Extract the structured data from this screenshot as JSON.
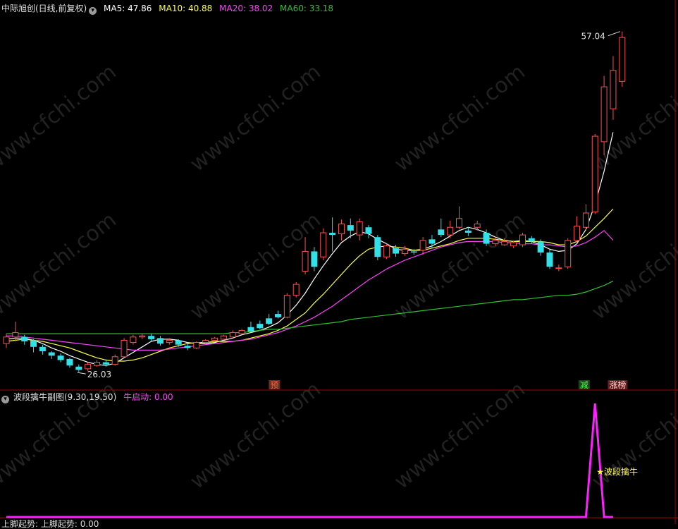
{
  "main_header": {
    "title": "中际旭创(日线,前复权)",
    "ma5": "MA5: 47.86",
    "ma10": "MA10: 40.88",
    "ma20": "MA20: 38.02",
    "ma60": "MA60: 33.18"
  },
  "sub_header": {
    "title": "波段擒牛副图(9.30,19.50)",
    "value": "牛启动: 0.00"
  },
  "footer_header": {
    "text": "上脚起势: 上脚起势: 0.00"
  },
  "watermark": "www.cfchi.com",
  "colors": {
    "up": "#ff5050",
    "down": "#33e0e8",
    "ma5": "#ffffff",
    "ma10": "#ffff40",
    "ma20": "#ff40ff",
    "ma60": "#30c030",
    "signal": "#ff20ff",
    "star": "#ffff40"
  },
  "chart_data": [
    {
      "type": "candlestick",
      "title": "中际旭创(日线,前复权)",
      "annotations": {
        "high": "57.04",
        "low": "26.03",
        "marks": [
          "预",
          "减",
          "涨榜"
        ]
      },
      "candles": [
        {
          "o": 28.6,
          "c": 29.2,
          "h": 29.5,
          "l": 28.2
        },
        {
          "o": 29.2,
          "c": 29.6,
          "h": 30.6,
          "l": 28.8
        },
        {
          "o": 29.2,
          "c": 28.8,
          "h": 29.4,
          "l": 28.5
        },
        {
          "o": 28.9,
          "c": 28.3,
          "h": 29.0,
          "l": 27.8
        },
        {
          "o": 28.3,
          "c": 27.9,
          "h": 28.5,
          "l": 27.6
        },
        {
          "o": 27.8,
          "c": 27.5,
          "h": 27.9,
          "l": 27.2
        },
        {
          "o": 27.5,
          "c": 27.1,
          "h": 27.7,
          "l": 26.9
        },
        {
          "o": 27.2,
          "c": 26.6,
          "h": 27.3,
          "l": 26.4
        },
        {
          "o": 26.5,
          "c": 26.2,
          "h": 26.7,
          "l": 26.03
        },
        {
          "o": 26.3,
          "c": 26.7,
          "h": 26.9,
          "l": 26.1
        },
        {
          "o": 26.6,
          "c": 26.9,
          "h": 27.1,
          "l": 26.5
        },
        {
          "o": 26.9,
          "c": 26.7,
          "h": 27.1,
          "l": 26.5
        },
        {
          "o": 26.7,
          "c": 27.4,
          "h": 27.6,
          "l": 26.6
        },
        {
          "o": 27.4,
          "c": 28.9,
          "h": 29.1,
          "l": 27.3
        },
        {
          "o": 28.7,
          "c": 29.2,
          "h": 29.4,
          "l": 28.5
        },
        {
          "o": 29.2,
          "c": 29.3,
          "h": 29.5,
          "l": 29.0
        },
        {
          "o": 29.3,
          "c": 29.0,
          "h": 29.5,
          "l": 28.8
        },
        {
          "o": 29.1,
          "c": 28.6,
          "h": 29.3,
          "l": 28.4
        },
        {
          "o": 28.7,
          "c": 28.9,
          "h": 29.1,
          "l": 28.5
        },
        {
          "o": 28.9,
          "c": 28.5,
          "h": 29.0,
          "l": 28.3
        },
        {
          "o": 28.4,
          "c": 28.2,
          "h": 28.6,
          "l": 28.0
        },
        {
          "o": 28.2,
          "c": 28.7,
          "h": 28.8,
          "l": 28.1
        },
        {
          "o": 28.7,
          "c": 28.9,
          "h": 29.0,
          "l": 28.6
        },
        {
          "o": 28.9,
          "c": 29.1,
          "h": 29.2,
          "l": 28.8
        },
        {
          "o": 29.0,
          "c": 29.3,
          "h": 29.4,
          "l": 28.9
        },
        {
          "o": 29.2,
          "c": 29.6,
          "h": 29.8,
          "l": 29.1
        },
        {
          "o": 29.5,
          "c": 29.8,
          "h": 29.9,
          "l": 29.4
        },
        {
          "o": 30.1,
          "c": 29.7,
          "h": 30.6,
          "l": 29.6
        },
        {
          "o": 30.4,
          "c": 30.0,
          "h": 30.7,
          "l": 29.9
        },
        {
          "o": 30.9,
          "c": 30.4,
          "h": 31.3,
          "l": 30.3
        },
        {
          "o": 31.3,
          "c": 31.0,
          "h": 31.6,
          "l": 30.9
        },
        {
          "o": 31.0,
          "c": 33.0,
          "h": 33.2,
          "l": 30.9
        },
        {
          "o": 33.0,
          "c": 34.0,
          "h": 34.2,
          "l": 32.8
        },
        {
          "o": 35.2,
          "c": 37.0,
          "h": 38.3,
          "l": 34.9
        },
        {
          "o": 37.0,
          "c": 35.6,
          "h": 37.4,
          "l": 35.2
        },
        {
          "o": 36.5,
          "c": 38.7,
          "h": 39.1,
          "l": 36.2
        },
        {
          "o": 38.7,
          "c": 38.5,
          "h": 40.1,
          "l": 37.0
        },
        {
          "o": 38.6,
          "c": 39.5,
          "h": 39.9,
          "l": 38.0
        },
        {
          "o": 39.4,
          "c": 38.9,
          "h": 40.0,
          "l": 38.2
        },
        {
          "o": 38.5,
          "c": 39.7,
          "h": 40.0,
          "l": 38.0
        },
        {
          "o": 39.2,
          "c": 38.6,
          "h": 39.4,
          "l": 38.2
        },
        {
          "o": 38.3,
          "c": 36.5,
          "h": 38.5,
          "l": 36.2
        },
        {
          "o": 36.5,
          "c": 37.5,
          "h": 37.7,
          "l": 36.3
        },
        {
          "o": 37.3,
          "c": 36.8,
          "h": 37.6,
          "l": 36.5
        },
        {
          "o": 36.8,
          "c": 37.2,
          "h": 37.5,
          "l": 36.6
        },
        {
          "o": 37.0,
          "c": 36.9,
          "h": 37.2,
          "l": 36.7
        },
        {
          "o": 37.1,
          "c": 38.0,
          "h": 38.3,
          "l": 36.7
        },
        {
          "o": 38.1,
          "c": 37.7,
          "h": 38.5,
          "l": 37.3
        },
        {
          "o": 39.0,
          "c": 38.5,
          "h": 40.0,
          "l": 38.3
        },
        {
          "o": 38.5,
          "c": 39.2,
          "h": 39.8,
          "l": 38.2
        },
        {
          "o": 39.2,
          "c": 40.0,
          "h": 41.1,
          "l": 39.0
        },
        {
          "o": 38.9,
          "c": 38.7,
          "h": 39.2,
          "l": 38.4
        },
        {
          "o": 39.2,
          "c": 39.5,
          "h": 39.8,
          "l": 38.9
        },
        {
          "o": 38.7,
          "c": 37.7,
          "h": 39.0,
          "l": 37.5
        },
        {
          "o": 37.7,
          "c": 38.0,
          "h": 38.3,
          "l": 37.5
        },
        {
          "o": 37.6,
          "c": 37.9,
          "h": 38.2,
          "l": 37.5
        },
        {
          "o": 37.5,
          "c": 37.8,
          "h": 38.0,
          "l": 37.3
        },
        {
          "o": 37.6,
          "c": 38.5,
          "h": 38.7,
          "l": 37.4
        },
        {
          "o": 38.2,
          "c": 37.9,
          "h": 38.4,
          "l": 37.7
        },
        {
          "o": 37.9,
          "c": 36.9,
          "h": 38.1,
          "l": 36.6
        },
        {
          "o": 36.9,
          "c": 35.6,
          "h": 37.2,
          "l": 35.4
        },
        {
          "o": 35.5,
          "c": 35.5,
          "h": 35.8,
          "l": 35.2
        },
        {
          "o": 35.6,
          "c": 38.0,
          "h": 38.2,
          "l": 35.4
        },
        {
          "o": 38.0,
          "c": 39.3,
          "h": 40.2,
          "l": 37.8
        },
        {
          "o": 39.2,
          "c": 40.5,
          "h": 41.3,
          "l": 38.9
        },
        {
          "o": 40.6,
          "c": 47.5,
          "h": 47.7,
          "l": 40.4
        },
        {
          "o": 47.0,
          "c": 52.0,
          "h": 53.0,
          "l": 45.8
        },
        {
          "o": 50.0,
          "c": 53.5,
          "h": 54.8,
          "l": 49.0
        },
        {
          "o": 52.5,
          "c": 56.5,
          "h": 57.04,
          "l": 52.0
        }
      ],
      "ma_series": [
        {
          "name": "MA5",
          "values": [
            29.0,
            29.1,
            29.1,
            28.9,
            28.6,
            28.2,
            27.9,
            27.5,
            27.2,
            26.9,
            26.7,
            26.6,
            26.8,
            27.3,
            27.8,
            28.3,
            28.8,
            29.0,
            29.0,
            28.9,
            28.7,
            28.6,
            28.6,
            28.7,
            28.9,
            29.1,
            29.4,
            29.6,
            29.8,
            30.1,
            30.5,
            31.2,
            32.1,
            33.2,
            34.5,
            35.7,
            36.8,
            37.8,
            38.4,
            38.8,
            38.6,
            38.1,
            37.7,
            37.2,
            37.1,
            37.1,
            37.2,
            37.5,
            37.9,
            38.4,
            38.9,
            39.2,
            39.0,
            38.7,
            38.3,
            38.0,
            37.9,
            38.0,
            37.9,
            37.6,
            37.2,
            37.0,
            37.1,
            37.7,
            39.0,
            41.3,
            44.3,
            47.86
          ]
        },
        {
          "name": "MA10",
          "values": [
            28.8,
            28.9,
            29.0,
            28.9,
            28.8,
            28.6,
            28.4,
            28.2,
            27.9,
            27.6,
            27.3,
            27.1,
            27.0,
            27.0,
            27.1,
            27.3,
            27.6,
            27.9,
            28.2,
            28.4,
            28.6,
            28.7,
            28.7,
            28.8,
            28.8,
            28.8,
            28.9,
            29.1,
            29.3,
            29.5,
            29.8,
            30.2,
            30.8,
            31.4,
            32.3,
            33.1,
            34.0,
            34.9,
            35.8,
            36.6,
            37.2,
            37.4,
            37.5,
            37.4,
            37.3,
            37.1,
            37.1,
            37.3,
            37.5,
            37.7,
            38.0,
            38.2,
            38.2,
            38.2,
            38.1,
            38.0,
            37.9,
            37.9,
            37.9,
            37.9,
            37.8,
            37.6,
            37.6,
            37.9,
            38.4,
            39.2,
            40.0,
            40.88
          ]
        },
        {
          "name": "MA20",
          "values": [
            29.3,
            29.3,
            29.2,
            29.1,
            29.0,
            28.9,
            28.8,
            28.7,
            28.6,
            28.5,
            28.4,
            28.3,
            28.2,
            28.1,
            28.0,
            28.0,
            28.0,
            28.0,
            28.1,
            28.2,
            28.3,
            28.4,
            28.5,
            28.6,
            28.7,
            28.8,
            28.9,
            29.0,
            29.2,
            29.4,
            29.6,
            29.9,
            30.2,
            30.6,
            31.0,
            31.5,
            32.0,
            32.6,
            33.2,
            33.8,
            34.4,
            34.9,
            35.4,
            35.8,
            36.2,
            36.5,
            36.8,
            37.1,
            37.4,
            37.6,
            37.8,
            37.9,
            37.9,
            37.9,
            37.9,
            37.8,
            37.8,
            37.7,
            37.7,
            37.6,
            37.6,
            37.5,
            37.4,
            37.5,
            37.8,
            38.3,
            38.9,
            38.02
          ]
        },
        {
          "name": "MA60",
          "values": [
            29.5,
            29.5,
            29.5,
            29.5,
            29.5,
            29.5,
            29.5,
            29.5,
            29.5,
            29.5,
            29.5,
            29.5,
            29.5,
            29.5,
            29.5,
            29.5,
            29.5,
            29.5,
            29.5,
            29.5,
            29.5,
            29.5,
            29.5,
            29.5,
            29.5,
            29.6,
            29.6,
            29.7,
            29.8,
            29.9,
            29.9,
            30.0,
            30.1,
            30.2,
            30.3,
            30.4,
            30.5,
            30.6,
            30.8,
            30.9,
            31.0,
            31.1,
            31.2,
            31.3,
            31.4,
            31.5,
            31.6,
            31.7,
            31.8,
            31.9,
            32.0,
            32.1,
            32.2,
            32.3,
            32.4,
            32.5,
            32.6,
            32.6,
            32.7,
            32.8,
            32.9,
            33.0,
            33.0,
            33.1,
            33.3,
            33.6,
            33.9,
            34.3
          ]
        }
      ],
      "ylim": [
        25.2,
        58.5
      ]
    },
    {
      "type": "line",
      "title": "波段擒牛副图(9.30,19.50)",
      "series": [
        {
          "name": "牛启动",
          "values": [
            0,
            0,
            0,
            0,
            0,
            0,
            0,
            0,
            0,
            0,
            0,
            0,
            0,
            0,
            0,
            0,
            0,
            0,
            0,
            0,
            0,
            0,
            0,
            0,
            0,
            0,
            0,
            0,
            0,
            0,
            0,
            0,
            0,
            0,
            0,
            0,
            0,
            0,
            0,
            0,
            0,
            0,
            0,
            0,
            0,
            0,
            0,
            0,
            0,
            0,
            0,
            0,
            0,
            0,
            0,
            0,
            0,
            0,
            0,
            0,
            0,
            0,
            0,
            0,
            0,
            1,
            0,
            0
          ]
        }
      ],
      "annotation": "★波段擒牛",
      "ylim": [
        0,
        1
      ]
    }
  ]
}
